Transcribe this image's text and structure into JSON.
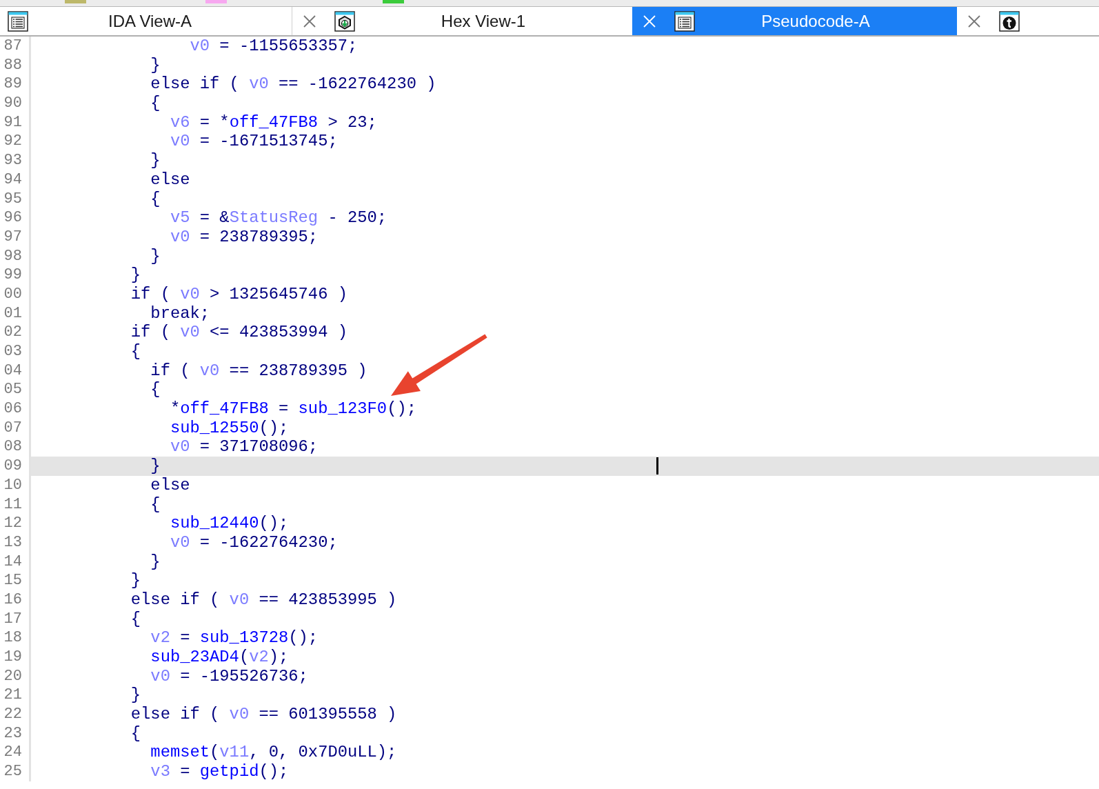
{
  "top_strip": {
    "swatches": [
      {
        "color": "#bdb86a"
      },
      {
        "color": "#f7a8f0"
      },
      {
        "color": "#3ccc3c"
      }
    ]
  },
  "tabs": [
    {
      "label": "IDA View-A",
      "kind": "listing",
      "closable": false,
      "selected": false
    },
    {
      "label": "Hex View-1",
      "kind": "hex",
      "closable": true,
      "selected": false
    },
    {
      "label": "Pseudocode-A",
      "kind": "listing",
      "closable": true,
      "selected": true
    },
    {
      "kind": "info",
      "closable": true,
      "selected": false
    }
  ],
  "code": {
    "lines": [
      {
        "number": "87",
        "selected": false,
        "tokens": [
          {
            "text": "                v0",
            "kind": "var"
          },
          {
            "text": " = -1155653357;",
            "kind": "plain"
          }
        ]
      },
      {
        "number": "88",
        "selected": false,
        "tokens": [
          {
            "text": "            }",
            "kind": "plain"
          }
        ]
      },
      {
        "number": "89",
        "selected": false,
        "tokens": [
          {
            "text": "            else if ( ",
            "kind": "plain"
          },
          {
            "text": "v0",
            "kind": "var"
          },
          {
            "text": " == -1622764230 )",
            "kind": "plain"
          }
        ]
      },
      {
        "number": "90",
        "selected": false,
        "tokens": [
          {
            "text": "            {",
            "kind": "plain"
          }
        ]
      },
      {
        "number": "91",
        "selected": false,
        "tokens": [
          {
            "text": "              v6",
            "kind": "var"
          },
          {
            "text": " = *",
            "kind": "plain"
          },
          {
            "text": "off_47FB8",
            "kind": "name"
          },
          {
            "text": " > 23;",
            "kind": "plain"
          }
        ]
      },
      {
        "number": "92",
        "selected": false,
        "tokens": [
          {
            "text": "              v0",
            "kind": "var"
          },
          {
            "text": " = -1671513745;",
            "kind": "plain"
          }
        ]
      },
      {
        "number": "93",
        "selected": false,
        "tokens": [
          {
            "text": "            }",
            "kind": "plain"
          }
        ]
      },
      {
        "number": "94",
        "selected": false,
        "tokens": [
          {
            "text": "            else",
            "kind": "plain"
          }
        ]
      },
      {
        "number": "95",
        "selected": false,
        "tokens": [
          {
            "text": "            {",
            "kind": "plain"
          }
        ]
      },
      {
        "number": "96",
        "selected": false,
        "tokens": [
          {
            "text": "              v5",
            "kind": "var"
          },
          {
            "text": " = &",
            "kind": "plain"
          },
          {
            "text": "StatusReg",
            "kind": "var"
          },
          {
            "text": " - 250;",
            "kind": "plain"
          }
        ]
      },
      {
        "number": "97",
        "selected": false,
        "tokens": [
          {
            "text": "              v0",
            "kind": "var"
          },
          {
            "text": " = 238789395;",
            "kind": "plain"
          }
        ]
      },
      {
        "number": "98",
        "selected": false,
        "tokens": [
          {
            "text": "            }",
            "kind": "plain"
          }
        ]
      },
      {
        "number": "99",
        "selected": false,
        "tokens": [
          {
            "text": "          }",
            "kind": "plain"
          }
        ]
      },
      {
        "number": "00",
        "selected": false,
        "tokens": [
          {
            "text": "          if ( ",
            "kind": "plain"
          },
          {
            "text": "v0",
            "kind": "var"
          },
          {
            "text": " > 1325645746 )",
            "kind": "plain"
          }
        ]
      },
      {
        "number": "01",
        "selected": false,
        "tokens": [
          {
            "text": "            break;",
            "kind": "plain"
          }
        ]
      },
      {
        "number": "02",
        "selected": false,
        "tokens": [
          {
            "text": "          if ( ",
            "kind": "plain"
          },
          {
            "text": "v0",
            "kind": "var"
          },
          {
            "text": " <= 423853994 )",
            "kind": "plain"
          }
        ]
      },
      {
        "number": "03",
        "selected": false,
        "tokens": [
          {
            "text": "          {",
            "kind": "plain"
          }
        ]
      },
      {
        "number": "04",
        "selected": false,
        "tokens": [
          {
            "text": "            if ( ",
            "kind": "plain"
          },
          {
            "text": "v0",
            "kind": "var"
          },
          {
            "text": " == 238789395 )",
            "kind": "plain"
          }
        ]
      },
      {
        "number": "05",
        "selected": false,
        "tokens": [
          {
            "text": "            {",
            "kind": "plain"
          }
        ]
      },
      {
        "number": "06",
        "selected": false,
        "tokens": [
          {
            "text": "              *",
            "kind": "plain"
          },
          {
            "text": "off_47FB8",
            "kind": "name"
          },
          {
            "text": " = ",
            "kind": "plain"
          },
          {
            "text": "sub_123F0",
            "kind": "name"
          },
          {
            "text": "();",
            "kind": "plain"
          }
        ]
      },
      {
        "number": "07",
        "selected": false,
        "tokens": [
          {
            "text": "              sub_12550",
            "kind": "name"
          },
          {
            "text": "();",
            "kind": "plain"
          }
        ]
      },
      {
        "number": "08",
        "selected": false,
        "tokens": [
          {
            "text": "              v0",
            "kind": "var"
          },
          {
            "text": " = 371708096;",
            "kind": "plain"
          }
        ]
      },
      {
        "number": "09",
        "selected": true,
        "tokens": [
          {
            "text": "            }",
            "kind": "plain"
          }
        ]
      },
      {
        "number": "10",
        "selected": false,
        "tokens": [
          {
            "text": "            else",
            "kind": "plain"
          }
        ]
      },
      {
        "number": "11",
        "selected": false,
        "tokens": [
          {
            "text": "            {",
            "kind": "plain"
          }
        ]
      },
      {
        "number": "12",
        "selected": false,
        "tokens": [
          {
            "text": "              sub_12440",
            "kind": "name"
          },
          {
            "text": "();",
            "kind": "plain"
          }
        ]
      },
      {
        "number": "13",
        "selected": false,
        "tokens": [
          {
            "text": "              v0",
            "kind": "var"
          },
          {
            "text": " = -1622764230;",
            "kind": "plain"
          }
        ]
      },
      {
        "number": "14",
        "selected": false,
        "tokens": [
          {
            "text": "            }",
            "kind": "plain"
          }
        ]
      },
      {
        "number": "15",
        "selected": false,
        "tokens": [
          {
            "text": "          }",
            "kind": "plain"
          }
        ]
      },
      {
        "number": "16",
        "selected": false,
        "tokens": [
          {
            "text": "          else if ( ",
            "kind": "plain"
          },
          {
            "text": "v0",
            "kind": "var"
          },
          {
            "text": " == 423853995 )",
            "kind": "plain"
          }
        ]
      },
      {
        "number": "17",
        "selected": false,
        "tokens": [
          {
            "text": "          {",
            "kind": "plain"
          }
        ]
      },
      {
        "number": "18",
        "selected": false,
        "tokens": [
          {
            "text": "            v2",
            "kind": "var"
          },
          {
            "text": " = ",
            "kind": "plain"
          },
          {
            "text": "sub_13728",
            "kind": "name"
          },
          {
            "text": "();",
            "kind": "plain"
          }
        ]
      },
      {
        "number": "19",
        "selected": false,
        "tokens": [
          {
            "text": "            sub_23AD4",
            "kind": "name"
          },
          {
            "text": "(",
            "kind": "plain"
          },
          {
            "text": "v2",
            "kind": "var"
          },
          {
            "text": ");",
            "kind": "plain"
          }
        ]
      },
      {
        "number": "20",
        "selected": false,
        "tokens": [
          {
            "text": "            v0",
            "kind": "var"
          },
          {
            "text": " = -195526736;",
            "kind": "plain"
          }
        ]
      },
      {
        "number": "21",
        "selected": false,
        "tokens": [
          {
            "text": "          }",
            "kind": "plain"
          }
        ]
      },
      {
        "number": "22",
        "selected": false,
        "tokens": [
          {
            "text": "          else if ( ",
            "kind": "plain"
          },
          {
            "text": "v0",
            "kind": "var"
          },
          {
            "text": " == 601395558 )",
            "kind": "plain"
          }
        ]
      },
      {
        "number": "23",
        "selected": false,
        "tokens": [
          {
            "text": "          {",
            "kind": "plain"
          }
        ]
      },
      {
        "number": "24",
        "selected": false,
        "tokens": [
          {
            "text": "            memset",
            "kind": "name"
          },
          {
            "text": "(",
            "kind": "plain"
          },
          {
            "text": "v11",
            "kind": "var"
          },
          {
            "text": ", 0, 0x7D0uLL);",
            "kind": "plain"
          }
        ]
      },
      {
        "number": "25",
        "selected": false,
        "tokens": [
          {
            "text": "            v3",
            "kind": "var"
          },
          {
            "text": " = ",
            "kind": "plain"
          },
          {
            "text": "getpid",
            "kind": "name"
          },
          {
            "text": "();",
            "kind": "plain"
          }
        ]
      }
    ]
  }
}
